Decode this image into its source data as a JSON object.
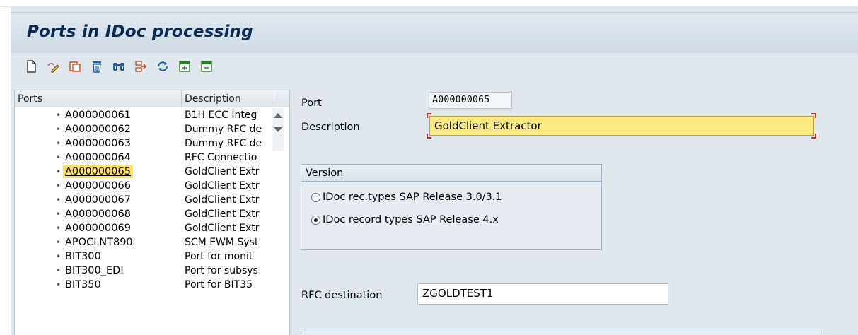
{
  "page_title": "Ports in IDoc processing",
  "toolbar": {
    "buttons": [
      {
        "name": "create-icon"
      },
      {
        "name": "change-icon"
      },
      {
        "name": "copy-icon"
      },
      {
        "name": "delete-icon"
      },
      {
        "name": "find-icon"
      },
      {
        "name": "where-used-icon"
      },
      {
        "name": "refresh-icon"
      },
      {
        "name": "expand-icon"
      },
      {
        "name": "collapse-icon"
      }
    ]
  },
  "ports_list": {
    "columns": [
      "Ports",
      "Description"
    ],
    "selected_port": "A000000065",
    "rows": [
      {
        "port": "A000000061",
        "description": "B1H ECC Integ"
      },
      {
        "port": "A000000062",
        "description": "Dummy RFC de"
      },
      {
        "port": "A000000063",
        "description": "Dummy RFC de"
      },
      {
        "port": "A000000064",
        "description": "RFC Connectio"
      },
      {
        "port": "A000000065",
        "description": "GoldClient Extr"
      },
      {
        "port": "A000000066",
        "description": "GoldClient Extr"
      },
      {
        "port": "A000000067",
        "description": "GoldClient Extr"
      },
      {
        "port": "A000000068",
        "description": "GoldClient Extr"
      },
      {
        "port": "A000000069",
        "description": "GoldClient Extr"
      },
      {
        "port": "APOCLNT890",
        "description": "SCM EWM Syst"
      },
      {
        "port": "BIT300",
        "description": "Port for monit"
      },
      {
        "port": "BIT300_EDI",
        "description": "Port for subsys"
      },
      {
        "port": "BIT350",
        "description": "Port for BIT35"
      }
    ]
  },
  "detail": {
    "port_label": "Port",
    "port_value": "A000000065",
    "description_label": "Description",
    "description_value": "GoldClient Extractor",
    "version": {
      "title": "Version",
      "options": [
        {
          "label": "IDoc rec.types SAP Release 3.0/3.1",
          "selected": false
        },
        {
          "label": "IDoc record types SAP Release 4.x",
          "selected": true
        }
      ]
    },
    "rfc_label": "RFC destination",
    "rfc_value": "ZGOLDTEST1"
  },
  "colors": {
    "selection": "#fde25d",
    "required_field": "#fde97e",
    "title_text": "#0a2a50"
  }
}
